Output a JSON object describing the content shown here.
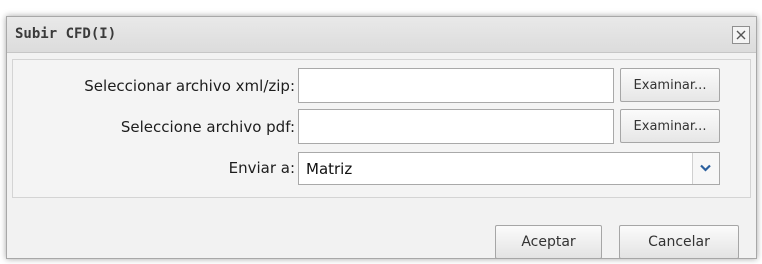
{
  "dialog": {
    "title": "Subir CFD(I)",
    "close_icon": "close-icon"
  },
  "form": {
    "xml_label": "Seleccionar archivo xml/zip:",
    "xml_value": "",
    "xml_browse_label": "Examinar...",
    "pdf_label": "Seleccione archivo pdf:",
    "pdf_value": "",
    "pdf_browse_label": "Examinar...",
    "send_to_label": "Enviar a:",
    "send_to_value": "Matriz",
    "dropdown_icon": "chevron-down-icon",
    "accent_color": "#2a5f9e"
  },
  "actions": {
    "accept_label": "Aceptar",
    "cancel_label": "Cancelar"
  }
}
